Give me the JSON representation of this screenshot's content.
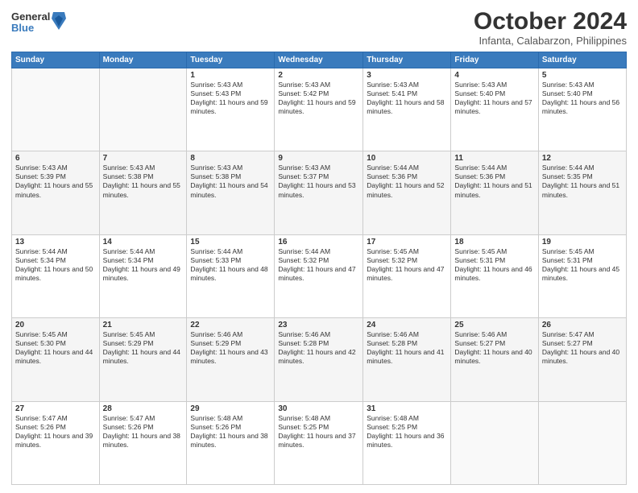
{
  "logo": {
    "general": "General",
    "blue": "Blue"
  },
  "header": {
    "month": "October 2024",
    "location": "Infanta, Calabarzon, Philippines"
  },
  "weekdays": [
    "Sunday",
    "Monday",
    "Tuesday",
    "Wednesday",
    "Thursday",
    "Friday",
    "Saturday"
  ],
  "weeks": [
    [
      {
        "day": "",
        "sunrise": "",
        "sunset": "",
        "daylight": ""
      },
      {
        "day": "",
        "sunrise": "",
        "sunset": "",
        "daylight": ""
      },
      {
        "day": "1",
        "sunrise": "Sunrise: 5:43 AM",
        "sunset": "Sunset: 5:43 PM",
        "daylight": "Daylight: 11 hours and 59 minutes."
      },
      {
        "day": "2",
        "sunrise": "Sunrise: 5:43 AM",
        "sunset": "Sunset: 5:42 PM",
        "daylight": "Daylight: 11 hours and 59 minutes."
      },
      {
        "day": "3",
        "sunrise": "Sunrise: 5:43 AM",
        "sunset": "Sunset: 5:41 PM",
        "daylight": "Daylight: 11 hours and 58 minutes."
      },
      {
        "day": "4",
        "sunrise": "Sunrise: 5:43 AM",
        "sunset": "Sunset: 5:40 PM",
        "daylight": "Daylight: 11 hours and 57 minutes."
      },
      {
        "day": "5",
        "sunrise": "Sunrise: 5:43 AM",
        "sunset": "Sunset: 5:40 PM",
        "daylight": "Daylight: 11 hours and 56 minutes."
      }
    ],
    [
      {
        "day": "6",
        "sunrise": "Sunrise: 5:43 AM",
        "sunset": "Sunset: 5:39 PM",
        "daylight": "Daylight: 11 hours and 55 minutes."
      },
      {
        "day": "7",
        "sunrise": "Sunrise: 5:43 AM",
        "sunset": "Sunset: 5:38 PM",
        "daylight": "Daylight: 11 hours and 55 minutes."
      },
      {
        "day": "8",
        "sunrise": "Sunrise: 5:43 AM",
        "sunset": "Sunset: 5:38 PM",
        "daylight": "Daylight: 11 hours and 54 minutes."
      },
      {
        "day": "9",
        "sunrise": "Sunrise: 5:43 AM",
        "sunset": "Sunset: 5:37 PM",
        "daylight": "Daylight: 11 hours and 53 minutes."
      },
      {
        "day": "10",
        "sunrise": "Sunrise: 5:44 AM",
        "sunset": "Sunset: 5:36 PM",
        "daylight": "Daylight: 11 hours and 52 minutes."
      },
      {
        "day": "11",
        "sunrise": "Sunrise: 5:44 AM",
        "sunset": "Sunset: 5:36 PM",
        "daylight": "Daylight: 11 hours and 51 minutes."
      },
      {
        "day": "12",
        "sunrise": "Sunrise: 5:44 AM",
        "sunset": "Sunset: 5:35 PM",
        "daylight": "Daylight: 11 hours and 51 minutes."
      }
    ],
    [
      {
        "day": "13",
        "sunrise": "Sunrise: 5:44 AM",
        "sunset": "Sunset: 5:34 PM",
        "daylight": "Daylight: 11 hours and 50 minutes."
      },
      {
        "day": "14",
        "sunrise": "Sunrise: 5:44 AM",
        "sunset": "Sunset: 5:34 PM",
        "daylight": "Daylight: 11 hours and 49 minutes."
      },
      {
        "day": "15",
        "sunrise": "Sunrise: 5:44 AM",
        "sunset": "Sunset: 5:33 PM",
        "daylight": "Daylight: 11 hours and 48 minutes."
      },
      {
        "day": "16",
        "sunrise": "Sunrise: 5:44 AM",
        "sunset": "Sunset: 5:32 PM",
        "daylight": "Daylight: 11 hours and 47 minutes."
      },
      {
        "day": "17",
        "sunrise": "Sunrise: 5:45 AM",
        "sunset": "Sunset: 5:32 PM",
        "daylight": "Daylight: 11 hours and 47 minutes."
      },
      {
        "day": "18",
        "sunrise": "Sunrise: 5:45 AM",
        "sunset": "Sunset: 5:31 PM",
        "daylight": "Daylight: 11 hours and 46 minutes."
      },
      {
        "day": "19",
        "sunrise": "Sunrise: 5:45 AM",
        "sunset": "Sunset: 5:31 PM",
        "daylight": "Daylight: 11 hours and 45 minutes."
      }
    ],
    [
      {
        "day": "20",
        "sunrise": "Sunrise: 5:45 AM",
        "sunset": "Sunset: 5:30 PM",
        "daylight": "Daylight: 11 hours and 44 minutes."
      },
      {
        "day": "21",
        "sunrise": "Sunrise: 5:45 AM",
        "sunset": "Sunset: 5:29 PM",
        "daylight": "Daylight: 11 hours and 44 minutes."
      },
      {
        "day": "22",
        "sunrise": "Sunrise: 5:46 AM",
        "sunset": "Sunset: 5:29 PM",
        "daylight": "Daylight: 11 hours and 43 minutes."
      },
      {
        "day": "23",
        "sunrise": "Sunrise: 5:46 AM",
        "sunset": "Sunset: 5:28 PM",
        "daylight": "Daylight: 11 hours and 42 minutes."
      },
      {
        "day": "24",
        "sunrise": "Sunrise: 5:46 AM",
        "sunset": "Sunset: 5:28 PM",
        "daylight": "Daylight: 11 hours and 41 minutes."
      },
      {
        "day": "25",
        "sunrise": "Sunrise: 5:46 AM",
        "sunset": "Sunset: 5:27 PM",
        "daylight": "Daylight: 11 hours and 40 minutes."
      },
      {
        "day": "26",
        "sunrise": "Sunrise: 5:47 AM",
        "sunset": "Sunset: 5:27 PM",
        "daylight": "Daylight: 11 hours and 40 minutes."
      }
    ],
    [
      {
        "day": "27",
        "sunrise": "Sunrise: 5:47 AM",
        "sunset": "Sunset: 5:26 PM",
        "daylight": "Daylight: 11 hours and 39 minutes."
      },
      {
        "day": "28",
        "sunrise": "Sunrise: 5:47 AM",
        "sunset": "Sunset: 5:26 PM",
        "daylight": "Daylight: 11 hours and 38 minutes."
      },
      {
        "day": "29",
        "sunrise": "Sunrise: 5:48 AM",
        "sunset": "Sunset: 5:26 PM",
        "daylight": "Daylight: 11 hours and 38 minutes."
      },
      {
        "day": "30",
        "sunrise": "Sunrise: 5:48 AM",
        "sunset": "Sunset: 5:25 PM",
        "daylight": "Daylight: 11 hours and 37 minutes."
      },
      {
        "day": "31",
        "sunrise": "Sunrise: 5:48 AM",
        "sunset": "Sunset: 5:25 PM",
        "daylight": "Daylight: 11 hours and 36 minutes."
      },
      {
        "day": "",
        "sunrise": "",
        "sunset": "",
        "daylight": ""
      },
      {
        "day": "",
        "sunrise": "",
        "sunset": "",
        "daylight": ""
      }
    ]
  ]
}
